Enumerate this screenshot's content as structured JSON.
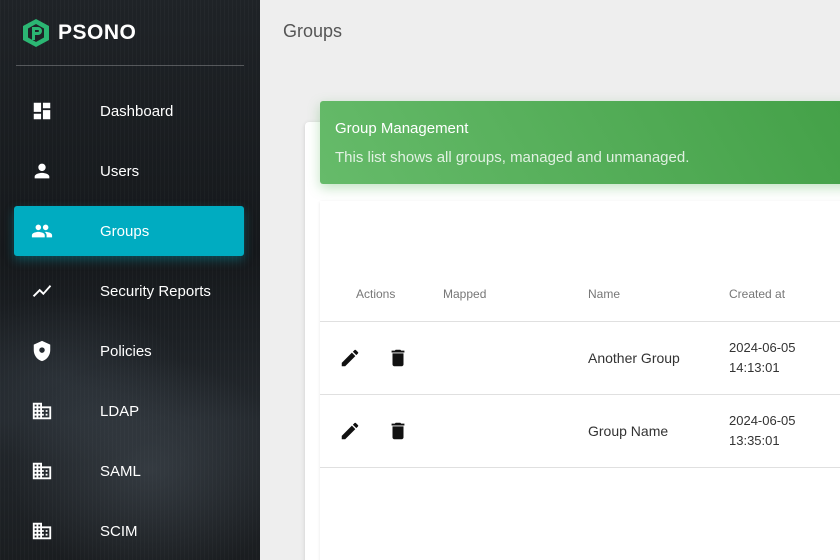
{
  "app": {
    "name": "PSONO"
  },
  "sidebar": {
    "items": [
      {
        "label": "Dashboard",
        "icon": "dashboard-icon"
      },
      {
        "label": "Users",
        "icon": "person-icon"
      },
      {
        "label": "Groups",
        "icon": "people-icon",
        "active": true
      },
      {
        "label": "Security Reports",
        "icon": "trending-icon"
      },
      {
        "label": "Policies",
        "icon": "shield-icon"
      },
      {
        "label": "LDAP",
        "icon": "business-icon"
      },
      {
        "label": "SAML",
        "icon": "business-icon"
      },
      {
        "label": "SCIM",
        "icon": "business-icon"
      }
    ]
  },
  "header": {
    "title": "Groups"
  },
  "banner": {
    "title": "Group Management",
    "subtitle": "This list shows all groups, managed and unmanaged.",
    "color": "#4caf50"
  },
  "table": {
    "columns": [
      "Actions",
      "Mapped",
      "Name",
      "Created at"
    ],
    "rows": [
      {
        "mapped": "",
        "name": "Another Group",
        "created_date": "2024-06-05",
        "created_time": "14:13:01"
      },
      {
        "mapped": "",
        "name": "Group Name",
        "created_date": "2024-06-05",
        "created_time": "13:35:01"
      }
    ]
  },
  "colors": {
    "accent": "#00acc1",
    "sidebar_bg": "#1a1d20",
    "banner": "#4caf50"
  }
}
